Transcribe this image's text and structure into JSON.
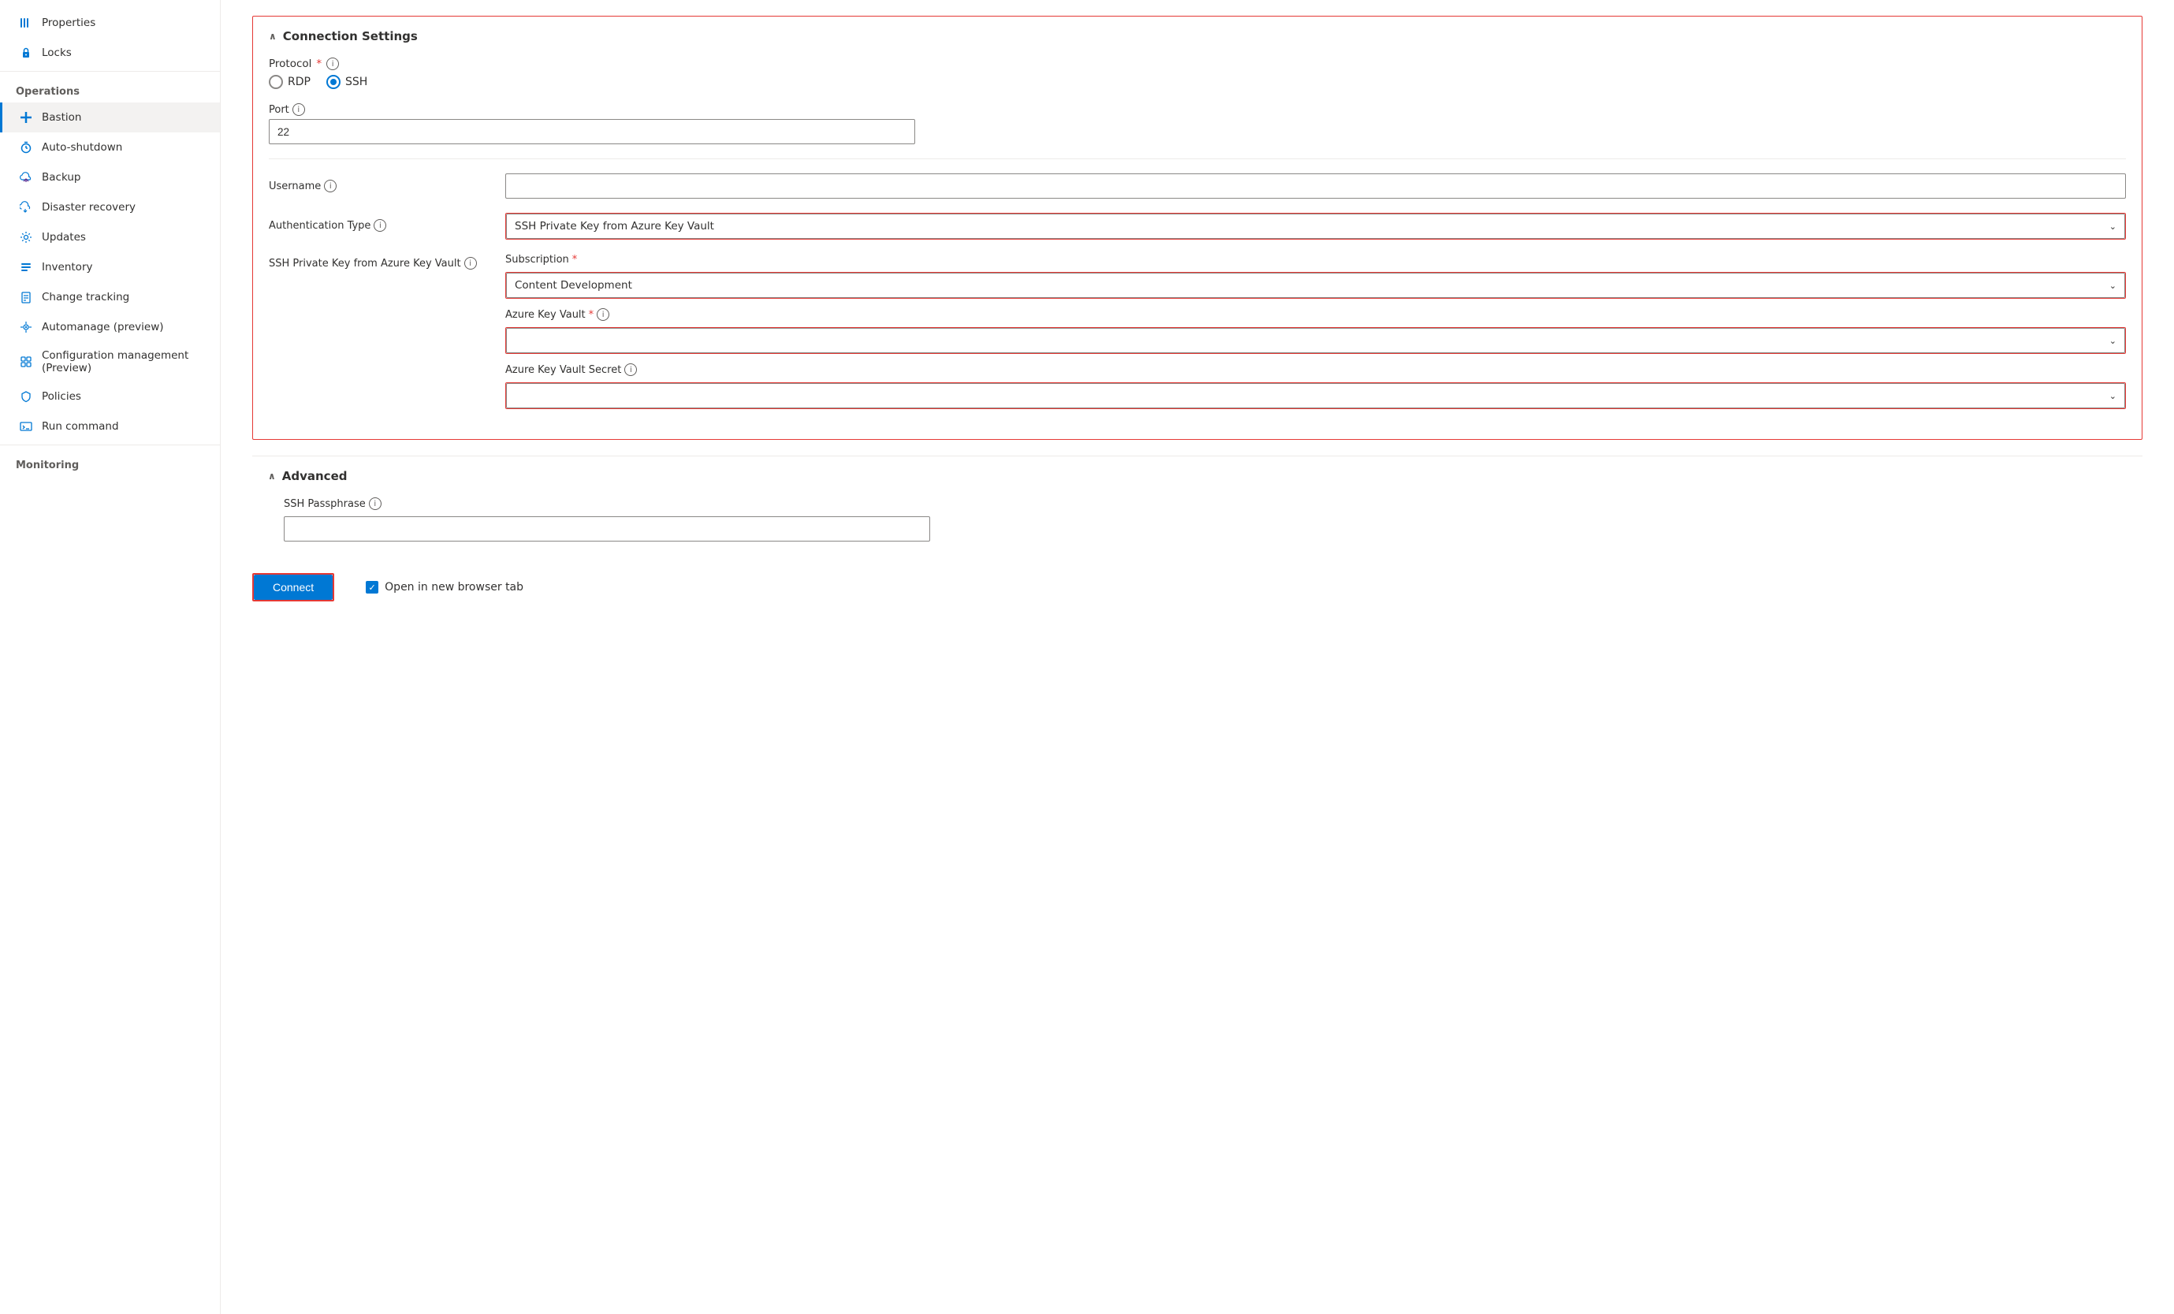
{
  "sidebar": {
    "items": [
      {
        "id": "properties",
        "label": "Properties",
        "icon": "bars-icon",
        "active": false,
        "section": null
      },
      {
        "id": "locks",
        "label": "Locks",
        "icon": "lock-icon",
        "active": false,
        "section": null
      },
      {
        "id": "operations-header",
        "label": "Operations",
        "isHeader": true
      },
      {
        "id": "bastion",
        "label": "Bastion",
        "icon": "cross-icon",
        "active": true,
        "section": "operations"
      },
      {
        "id": "auto-shutdown",
        "label": "Auto-shutdown",
        "icon": "clock-icon",
        "active": false,
        "section": "operations"
      },
      {
        "id": "backup",
        "label": "Backup",
        "icon": "cloud-icon",
        "active": false,
        "section": "operations"
      },
      {
        "id": "disaster-recovery",
        "label": "Disaster recovery",
        "icon": "cloud-sync-icon",
        "active": false,
        "section": "operations"
      },
      {
        "id": "updates",
        "label": "Updates",
        "icon": "gear-icon",
        "active": false,
        "section": "operations"
      },
      {
        "id": "inventory",
        "label": "Inventory",
        "icon": "list-icon",
        "active": false,
        "section": "operations"
      },
      {
        "id": "change-tracking",
        "label": "Change tracking",
        "icon": "doc-icon",
        "active": false,
        "section": "operations"
      },
      {
        "id": "automanage",
        "label": "Automanage (preview)",
        "icon": "sparkle-icon",
        "active": false,
        "section": "operations"
      },
      {
        "id": "config-mgmt",
        "label": "Configuration management (Preview)",
        "icon": "config-icon",
        "active": false,
        "section": "operations"
      },
      {
        "id": "policies",
        "label": "Policies",
        "icon": "shield-icon",
        "active": false,
        "section": "operations"
      },
      {
        "id": "run-command",
        "label": "Run command",
        "icon": "terminal-icon",
        "active": false,
        "section": "operations"
      },
      {
        "id": "monitoring-header",
        "label": "Monitoring",
        "isHeader": true
      }
    ]
  },
  "connection_settings": {
    "title": "Connection Settings",
    "protocol_label": "Protocol",
    "protocol_required": "*",
    "rdp_label": "RDP",
    "ssh_label": "SSH",
    "selected_protocol": "SSH",
    "port_label": "Port",
    "port_value": "22",
    "divider": true,
    "username_label": "Username",
    "username_placeholder": "",
    "auth_type_label": "Authentication Type",
    "auth_type_value": "SSH Private Key from Azure Key Vault",
    "ssh_key_label": "SSH Private Key from Azure Key Vault",
    "subscription_label": "Subscription",
    "subscription_required": "*",
    "subscription_value": "Content Development",
    "azure_key_vault_label": "Azure Key Vault",
    "azure_key_vault_required": "*",
    "azure_key_vault_value": "",
    "azure_secret_label": "Azure Key Vault Secret",
    "azure_secret_value": ""
  },
  "advanced": {
    "title": "Advanced",
    "ssh_passphrase_label": "SSH Passphrase",
    "ssh_passphrase_value": ""
  },
  "footer": {
    "connect_label": "Connect",
    "open_new_tab_label": "Open in new browser tab"
  }
}
